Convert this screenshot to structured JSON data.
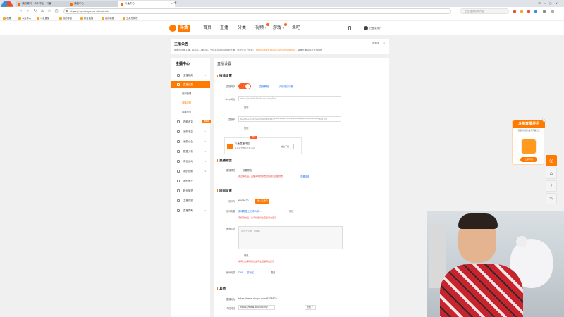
{
  "browser": {
    "logo_label": "360极速浏览器",
    "tabs": [
      {
        "label": "我的资料 - 个人中心 - 斗鱼",
        "active": false
      },
      {
        "label": "我的中心",
        "active": false
      },
      {
        "label": "斗鱼中心",
        "active": true
      }
    ],
    "url": "https://mp.douyu.com/live/main",
    "search_placeholder": "正在搜索相关内容",
    "bookmarks": [
      "收藏",
      "斗鱼中心",
      "斗鱼直播",
      "我的导航",
      "抖音直播",
      "我的收藏",
      "工具栏管理"
    ]
  },
  "site": {
    "logo": "斗鱼",
    "nav": [
      "首页",
      "直播",
      "分类",
      "视频",
      "游戏",
      "鱼吧"
    ],
    "username": "已登录用户"
  },
  "notice": {
    "title": "主播公告",
    "body": "尊敬的斗鱼主播，请前往主播中心，完成实名认证后即可开播，请遵守以下规范：",
    "link": "https://www.douyu.com/cms/gong/...",
    "body_tail": "直播开播请点击开播按钮",
    "close": "我知道了 ×"
  },
  "sidebar": {
    "title": "主播中心",
    "items": [
      {
        "label": "主播福利"
      },
      {
        "label": "直播设置",
        "active": true
      },
      {
        "label": "视频收益"
      },
      {
        "label": "我的收益"
      },
      {
        "label": "我的公会"
      },
      {
        "label": "数据分析"
      },
      {
        "label": "商业活动"
      },
      {
        "label": "我的视频"
      },
      {
        "label": "我的房产"
      },
      {
        "label": "粉丝管理"
      },
      {
        "label": "主播课堂"
      },
      {
        "label": "直播帮助"
      }
    ],
    "subitems": [
      "房间管理",
      "直播设置",
      "直播日历"
    ],
    "new_tag": "NEW"
  },
  "main": {
    "title": "直播设置",
    "push": {
      "section": "推流设置",
      "switch_label": "直播开关",
      "switch_links": [
        "直播教程",
        "开播常见问题"
      ],
      "rtmp_label": "rtmp地址",
      "rtmp_value": "rtmp://sendtc3a.douyu.com/live",
      "rtmp_copy": "复制",
      "code_label": "直播码",
      "code_value": "6208622rKs5sIuxfTwxSecret=****************************************8eeTfw",
      "code_copy": "复制",
      "companion_name": "斗鱼直播伴侣",
      "companion_desc": "斗鱼官方推荐开播工具",
      "companion_download": "前往下载",
      "companion_badge": "推荐"
    },
    "preview": {
      "section": "直播预告",
      "label": "直播预告",
      "status": "设置预告",
      "warning": "通过审核后，直播间中的预告位将展示直播预告",
      "link": "查看说明"
    },
    "room": {
      "section": "房间设置",
      "room_id_label": "房间号",
      "room_id": "6208622",
      "room_id_btn": "进入直播间",
      "title_label": "房间标题",
      "title_value": "英雄联盟上分冲大师…",
      "title_edit": "修改",
      "title_warning": "审核通过后，房间标题将在直播间内显示",
      "notice_label": "房间公告",
      "notice_placeholder": "说点什么吧（选填）",
      "notice_edit": "修改",
      "notice_warning": "房间公告审核通过后可在直播间内显示",
      "category_label": "房间分类",
      "category_value": "DNF — 游戏区",
      "category_edit": "更改"
    },
    "other": {
      "section": "其他",
      "live_url_label": "直播地址",
      "live_url": "https://www.douyu.com/6208622",
      "short_url_label": "个性域名",
      "short_url": "https://www.douyu.com/",
      "short_url_action": "修改"
    }
  },
  "promo": {
    "title": "斗鱼直播伴侣",
    "desc": "直播伴侣官方推荐开播工具",
    "button": "立即下载"
  },
  "colors": {
    "accent": "#ff7a00",
    "link": "#2b7ce9",
    "warning": "#e8463a"
  }
}
